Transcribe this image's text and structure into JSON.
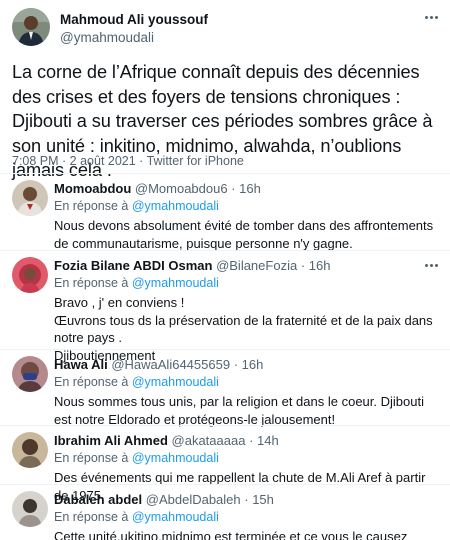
{
  "main_tweet": {
    "author_name": "Mahmoud Ali youssouf",
    "author_handle": "@ymahmoudali",
    "text": "La corne de l’Afrique connaît depuis des décennies des crises et des foyers de tensions chroniques : Djibouti a su traverser ces périodes sombres grâce à son unité : inkitino, midnimo, alwahda, n’oublions jamais cela .",
    "meta": "7:08 PM · 2 août 2021 · Twitter for iPhone"
  },
  "replies": [
    {
      "name": "Momoabdou",
      "handle": "@Momoabdou6",
      "time": "· 16h",
      "reply_prefix": "En réponse à ",
      "reply_to": "@ymahmoudali",
      "text": "Nous devons absolument évité de tomber dans des affrontements de communautarisme, puisque personne n'y gagne.",
      "avatar_color": "#c9c0b2"
    },
    {
      "name": "Fozia Bilane ABDI Osman",
      "handle": "@BilaneFozia",
      "time": "· 16h",
      "reply_prefix": "En réponse à ",
      "reply_to": "@ymahmoudali",
      "text": "Bravo , j' en conviens !\nŒuvrons tous ds la préservation de la fraternité et de la paix dans notre pays .\nDjiboutiennement",
      "avatar_color": "#d94a5a"
    },
    {
      "name": "Hawa Ali",
      "handle": "@HawaAli64455659",
      "time": "· 16h",
      "reply_prefix": "En réponse à ",
      "reply_to": "@ymahmoudali",
      "text": "Nous sommes tous unis, par la religion et dans le coeur. Djibouti est notre Eldorado et protégeons-le jalousement!",
      "avatar_color": "#9c6a6e"
    },
    {
      "name": "Ibrahim Ali Ahmed",
      "handle": "@akataaaaa",
      "time": "· 14h",
      "reply_prefix": "En réponse à ",
      "reply_to": "@ymahmoudali",
      "text": "Des événements qui me rappellent la chute de M.Ali Aref à partir de 1975.",
      "avatar_color": "#b8a48a"
    },
    {
      "name": "Dabaleh abdel",
      "handle": "@AbdelDabaleh",
      "time": "· 15h",
      "reply_prefix": "En réponse à ",
      "reply_to": "@ymahmoudali",
      "text": "Cette unité,ukitino,midnimo est terminée et ce vous le causez",
      "avatar_color": "#a8a29a"
    }
  ],
  "colors": {
    "accent": "#1d9bf0",
    "secondary_text": "#536471",
    "primary_text": "#0f1419",
    "divider": "#eff3f4"
  },
  "icons": {
    "more": "more-horizontal-icon"
  }
}
